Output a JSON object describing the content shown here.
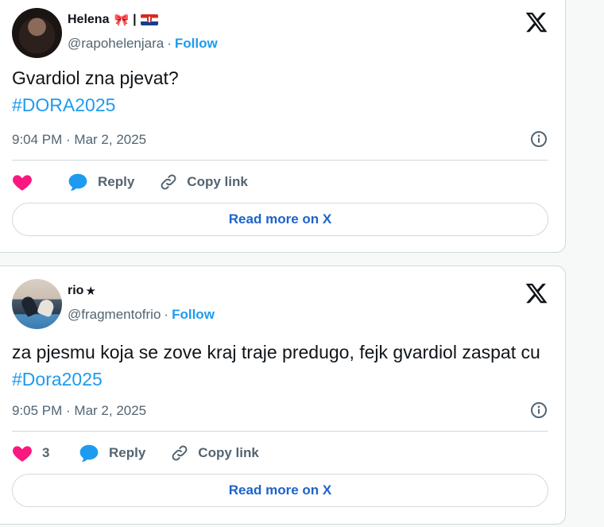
{
  "tweets": [
    {
      "display_name": "Helena",
      "name_decoration": "|",
      "handle": "@rapohelenjara",
      "follow_label": "Follow",
      "text": "Gvardiol zna pjevat?",
      "hashtag": "#DORA2025",
      "timestamp": "9:04 PM · Mar 2, 2025",
      "like_count": "",
      "reply_label": "Reply",
      "copy_label": "Copy link",
      "read_more_label": "Read more on X"
    },
    {
      "display_name": "rio",
      "name_decoration": "★",
      "handle": "@fragmentofrio",
      "follow_label": "Follow",
      "text": "za pjesmu koja se zove kraj traje predugo, fejk gvardiol zaspat cu",
      "hashtag": "#Dora2025",
      "timestamp": "9:05 PM · Mar 2, 2025",
      "like_count": "3",
      "reply_label": "Reply",
      "copy_label": "Copy link",
      "read_more_label": "Read more on X"
    }
  ],
  "separator_dot": "·",
  "colors": {
    "accent_blue": "#1d9bf0",
    "heart_pink": "#f91880",
    "muted_text": "#536471",
    "border": "#cfd9de"
  },
  "icons": [
    "x-logo-icon",
    "info-icon",
    "heart-icon",
    "reply-bubble-icon",
    "link-icon",
    "bow-icon",
    "croatia-flag-icon"
  ]
}
